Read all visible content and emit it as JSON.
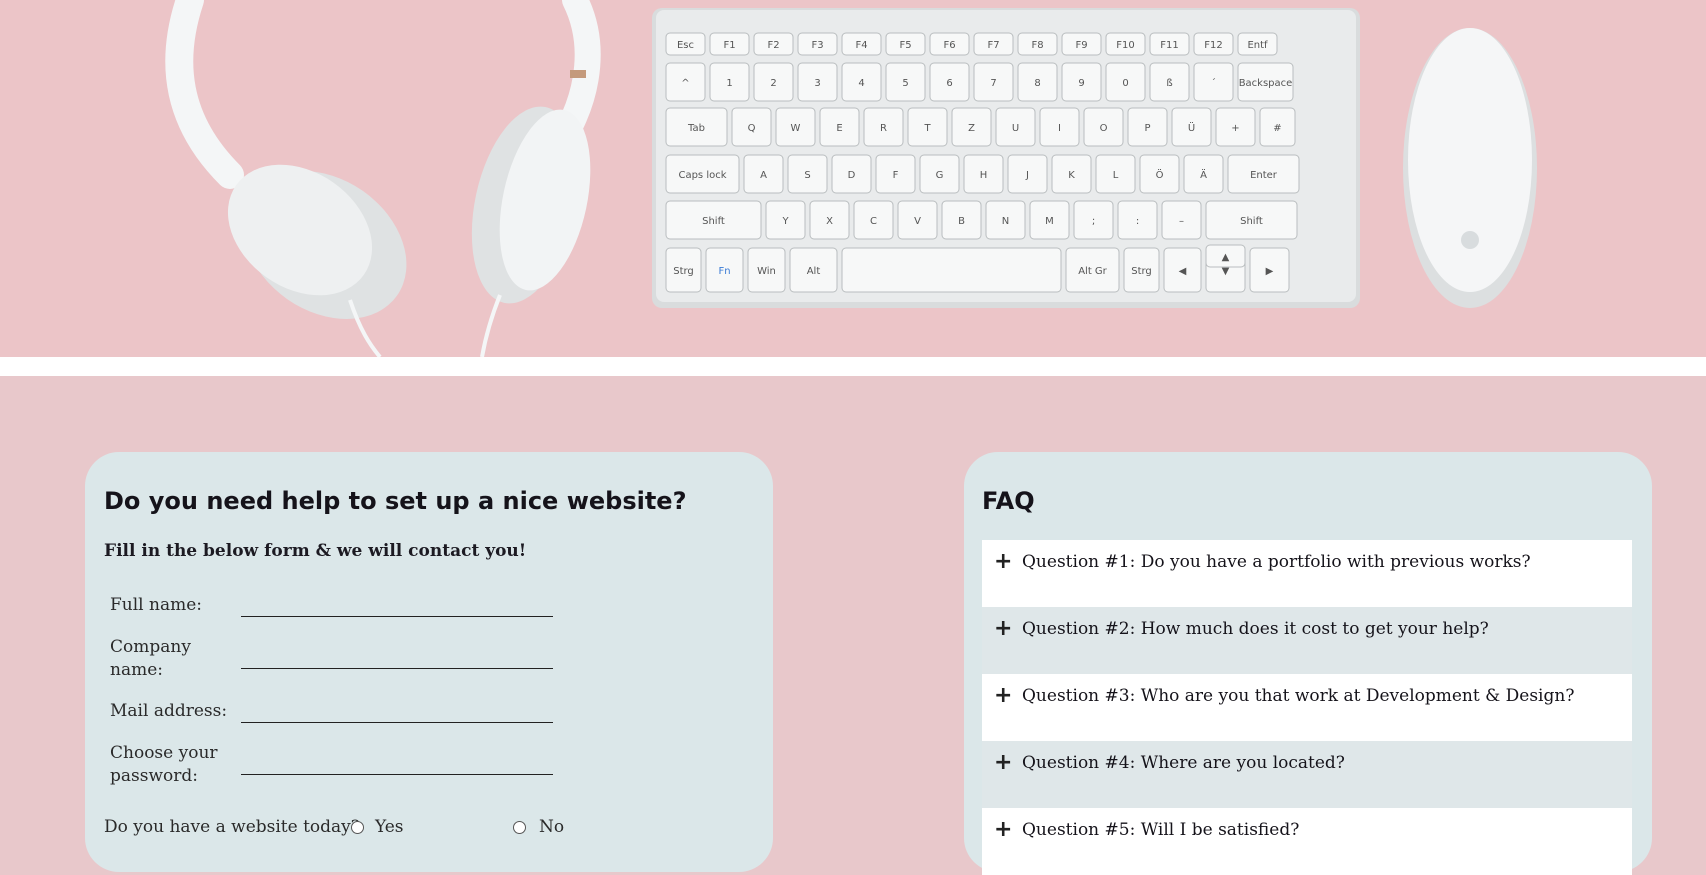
{
  "hero": {
    "image_subject": "headphones-keyboard-mouse-on-pink",
    "keys_row1": [
      "Esc",
      "F1",
      "F2",
      "F3",
      "F4",
      "F5",
      "F6",
      "F7",
      "F8",
      "F9",
      "F10",
      "F11",
      "F12",
      "Entf"
    ],
    "keys_row2": [
      "^",
      "1",
      "2",
      "3",
      "4",
      "5",
      "6",
      "7",
      "8",
      "9",
      "0",
      "ß",
      "´",
      "Backspace"
    ],
    "keys_row3": [
      "Tab",
      "Q",
      "W",
      "E",
      "R",
      "T",
      "Z",
      "U",
      "I",
      "O",
      "P",
      "Ü",
      "+",
      "#"
    ],
    "keys_row4": [
      "Caps lock",
      "A",
      "S",
      "D",
      "F",
      "G",
      "H",
      "J",
      "K",
      "L",
      "Ö",
      "Ä",
      "Enter"
    ],
    "keys_row5": [
      "Shift",
      "Y",
      "X",
      "C",
      "V",
      "B",
      "N",
      "M",
      ";",
      ":",
      "–",
      "Shift"
    ],
    "keys_row6": [
      "Strg",
      "Fn",
      "Win",
      "Alt",
      "",
      "Alt Gr",
      "Strg",
      "◀",
      "▼",
      "▶"
    ],
    "key_up": "▲"
  },
  "form": {
    "title": "Do you need help to set up a nice website?",
    "subtitle": "Fill in the below form & we will contact you!",
    "fields": [
      {
        "label": "Full name:",
        "value": ""
      },
      {
        "label": "Company name:",
        "value": ""
      },
      {
        "label": "Mail address:",
        "value": ""
      },
      {
        "label": "Choose your password:",
        "value": ""
      }
    ],
    "website_question": "Do you have a website today?",
    "option_yes": "Yes",
    "option_no": "No"
  },
  "faq": {
    "title": "FAQ",
    "items": [
      {
        "icon": "plus-icon",
        "symbol": "+",
        "text": "Question #1: Do you have a portfolio with previous works?"
      },
      {
        "icon": "plus-icon",
        "symbol": "+",
        "text": "Question #2: How much does it cost to get your help?"
      },
      {
        "icon": "plus-icon",
        "symbol": "+",
        "text": "Question #3: Who are you that work at Development & Design?"
      },
      {
        "icon": "plus-icon",
        "symbol": "+",
        "text": "Question #4: Where are you located?"
      },
      {
        "icon": "plus-icon",
        "symbol": "+",
        "text": "Question #5: Will I be satisfied?"
      }
    ]
  },
  "colors": {
    "background": "#e8c8cb",
    "hero_background": "#ecc5c8",
    "card": "#dbe7e9",
    "faq_row_light": "#ffffff",
    "faq_row_shade": "#dfe7e9"
  }
}
